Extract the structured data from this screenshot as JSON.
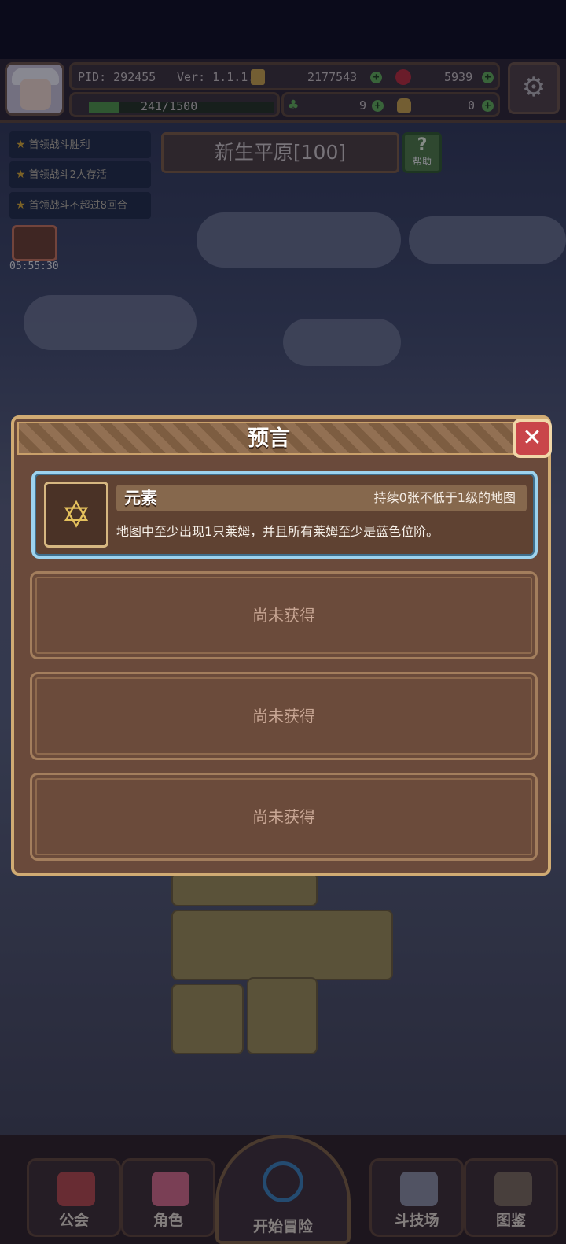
{
  "hud": {
    "pid": "PID: 292455",
    "version": "Ver: 1.1.1.0",
    "gold": "2177543",
    "gems": "5939",
    "xp": "241/1500",
    "xp_progress": 0.16,
    "clovers": "9",
    "bags": "0"
  },
  "quests": [
    "首领战斗胜利",
    "首领战斗2人存活",
    "首领战斗不超过8回合"
  ],
  "chest_timer": "05:55:30",
  "map": {
    "name": "新生平原[100]",
    "help_label": "帮助"
  },
  "modal": {
    "title": "预言",
    "close_symbol": "✕",
    "prophecy": {
      "name": "元素",
      "duration": "持续0张不低于1级的地图",
      "description": "地图中至少出现1只莱姆，并且所有莱姆至少是蓝色位阶。",
      "icon": "hexagram-icon"
    },
    "locked_slots": [
      "尚未获得",
      "尚未获得",
      "尚未获得"
    ]
  },
  "nav": {
    "guild": "公会",
    "character": "角色",
    "start": "开始冒险",
    "arena": "斗技场",
    "codex": "图鉴"
  },
  "colors": {
    "accent_gold": "#d0ab73",
    "card_highlight": "#9dd3ee",
    "close_red": "#c9454a"
  }
}
